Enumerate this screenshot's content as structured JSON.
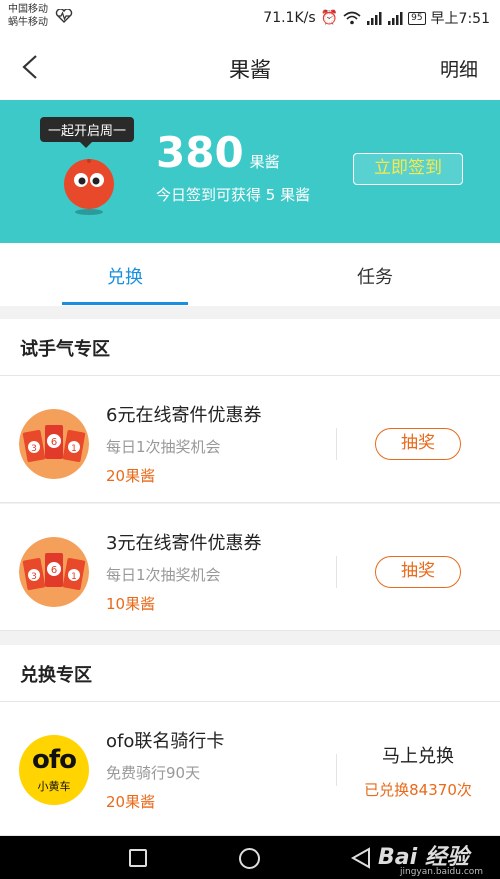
{
  "status_bar": {
    "carrier1": "中国移动",
    "carrier2": "蜗牛移动",
    "speed": "71.1K/s",
    "battery": "95",
    "time": "早上7:51"
  },
  "nav": {
    "title": "果酱",
    "detail_label": "明细"
  },
  "banner": {
    "tooltip": "一起开启周一",
    "points": "380",
    "points_unit": "果酱",
    "subtitle": "今日签到可获得 5 果酱",
    "signin_label": "立即签到"
  },
  "tabs": [
    {
      "label": "兑换",
      "active": true
    },
    {
      "label": "任务",
      "active": false
    }
  ],
  "sections": {
    "trial": "试手气专区",
    "exchange": "兑换专区"
  },
  "trial_items": [
    {
      "title": "6元在线寄件优惠券",
      "sub": "每日1次抽奖机会",
      "price": "20果酱",
      "action": "抽奖"
    },
    {
      "title": "3元在线寄件优惠券",
      "sub": "每日1次抽奖机会",
      "price": "10果酱",
      "action": "抽奖"
    }
  ],
  "exchange_items": [
    {
      "title": "ofo联名骑行卡",
      "sub": "免费骑行90天",
      "price": "20果酱",
      "action": "马上兑换",
      "redeemed": "已兑换84370次",
      "logo_text": "ofo",
      "logo_sub": "小黄车"
    }
  ],
  "watermark": {
    "text": "Bai 经验",
    "sub": "jingyan.baidu.com"
  },
  "colors": {
    "accent": "#1a8fe0",
    "banner": "#3ec9c9",
    "orange": "#e86a1a",
    "signin_text": "#f7e94a"
  }
}
